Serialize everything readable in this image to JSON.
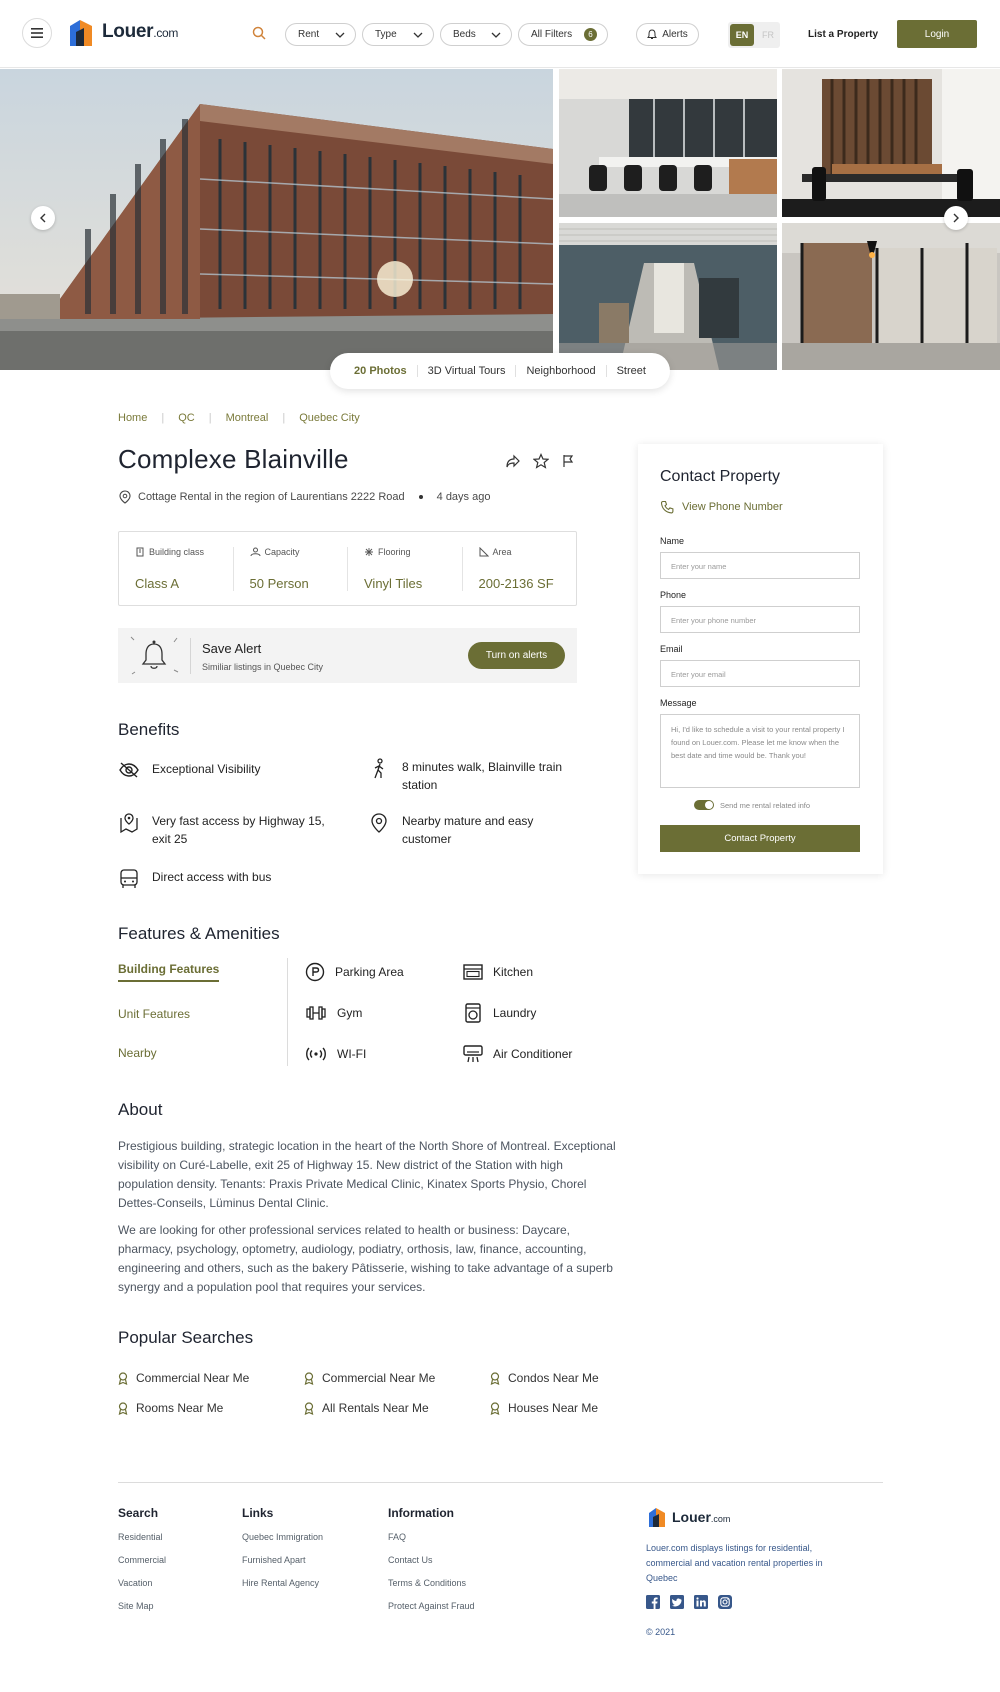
{
  "header": {
    "logo_text": "Louer",
    "logo_suffix": ".com",
    "filters": [
      {
        "label": "Rent"
      },
      {
        "label": "Type"
      },
      {
        "label": "Beds"
      }
    ],
    "all_filters_label": "All Filters",
    "all_filters_count": "6",
    "alerts_label": "Alerts",
    "lang_en": "EN",
    "lang_fr": "FR",
    "list_property": "List a Property",
    "login": "Login"
  },
  "gallery": {
    "tabs": [
      "20 Photos",
      "3D Virtual Tours",
      "Neighborhood",
      "Street"
    ]
  },
  "breadcrumb": [
    "Home",
    "QC",
    "Montreal",
    "Quebec City"
  ],
  "listing": {
    "title": "Complexe Blainville",
    "subtitle": "Cottage Rental in the region of Laurentians 2222 Road",
    "posted": "4 days ago",
    "specs": [
      {
        "label": "Building class",
        "value": "Class A",
        "icon": "building-icon"
      },
      {
        "label": "Capacity",
        "value": "50 Person",
        "icon": "people-icon"
      },
      {
        "label": "Flooring",
        "value": "Vinyl Tiles",
        "icon": "flooring-icon"
      },
      {
        "label": "Area",
        "value": "200-2136 SF",
        "icon": "area-icon"
      }
    ]
  },
  "save_alert": {
    "title": "Save Alert",
    "subtitle": "Similiar listings in Quebec City",
    "button": "Turn on alerts"
  },
  "benefits": {
    "heading": "Benefits",
    "items": [
      "Exceptional Visibility",
      "8 minutes walk, Blainville train station",
      "Very fast access by Highway 15, exit 25",
      "Nearby mature and easy customer",
      "Direct access with bus"
    ]
  },
  "amenities": {
    "heading": "Features & Amenities",
    "tabs": [
      "Building Features",
      "Unit Features",
      "Nearby"
    ],
    "items": [
      "Parking Area",
      "Kitchen",
      "Gym",
      "Laundry",
      "WI-FI",
      "Air Conditioner"
    ]
  },
  "about": {
    "heading": "About",
    "p1": "Prestigious building, strategic location in the heart of the North Shore of Montreal. Exceptional visibility on Curé-Labelle, exit 25 of Highway 15. New district of the Station with high population density. Tenants: Praxis Private Medical Clinic, Kinatex Sports Physio, Chorel Dettes-Conseils, Lüminus Dental Clinic.",
    "p2": "We are looking for other professional services related to health or business: Daycare, pharmacy, psychology, optometry, audiology, podiatry, orthosis, law, finance, accounting, engineering and others, such as the bakery Pâtisserie, wishing to take advantage of a superb synergy and a population pool that requires your services."
  },
  "popular": {
    "heading": "Popular Searches",
    "items": [
      "Commercial Near Me",
      "Commercial Near Me",
      "Condos Near Me",
      "Rooms Near Me",
      "All Rentals Near Me",
      "Houses Near Me"
    ]
  },
  "contact": {
    "title": "Contact Property",
    "phone_link": "View Phone Number",
    "name_label": "Name",
    "name_placeholder": "Enter your name",
    "phone_label": "Phone",
    "phone_placeholder": "Enter your phone number",
    "email_label": "Email",
    "email_placeholder": "Enter your email",
    "message_label": "Message",
    "message_value": "Hi, I'd like to schedule a visit to your rental property I found on Louer.com. Please let me know when the best date and time would be. Thank you!",
    "toggle_label": "Send me rental related info",
    "button": "Contact Property"
  },
  "footer": {
    "search": {
      "heading": "Search",
      "items": [
        "Residential",
        "Commercial",
        "Vacation",
        "Site Map"
      ]
    },
    "links": {
      "heading": "Links",
      "items": [
        "Quebec Immigration",
        "Furnished Apart",
        "Hire Rental Agency"
      ]
    },
    "information": {
      "heading": "Information",
      "items": [
        "FAQ",
        "Contact Us",
        "Terms & Conditions",
        "Protect Against Fraud"
      ]
    },
    "logo_text": "Louer",
    "logo_suffix": ".com",
    "description": "Louer.com displays listings for residential, commercial and vacation rental properties in Quebec",
    "copyright": "© 2021"
  },
  "colors": {
    "accent": "#6b6e35",
    "text": "#1f2430",
    "footer_link": "#37578a"
  }
}
